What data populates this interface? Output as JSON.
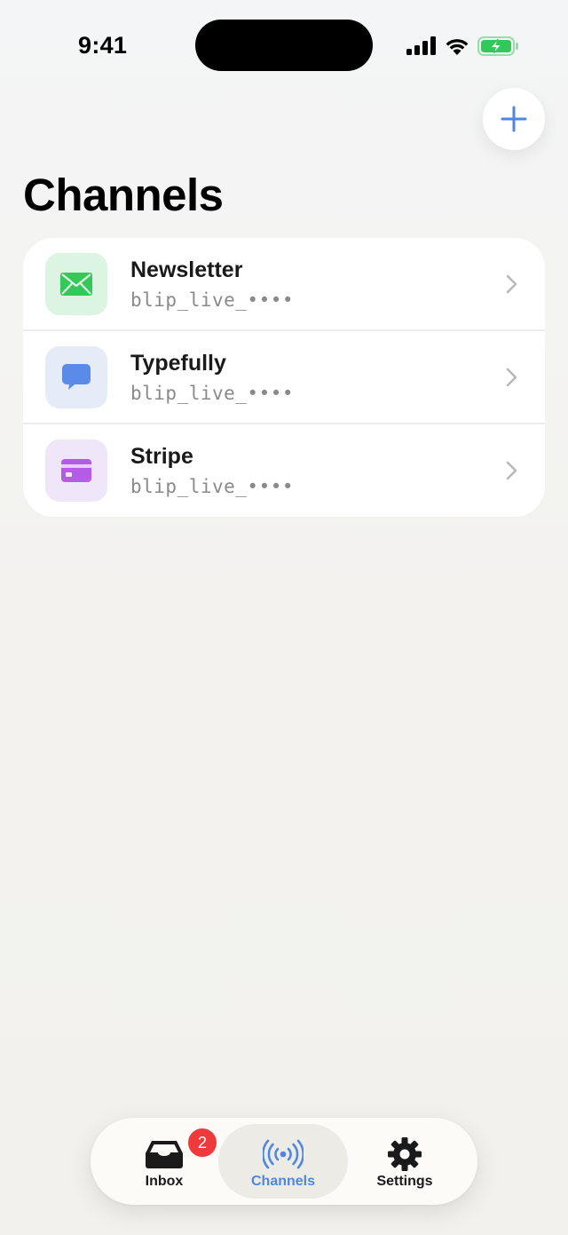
{
  "status_bar": {
    "time": "9:41",
    "icons": [
      "cellular-signal-icon",
      "wifi-icon",
      "battery-charging-icon"
    ],
    "battery_color": "#34c759"
  },
  "header": {
    "add_icon": "plus-icon",
    "title": "Channels"
  },
  "channels": [
    {
      "name": "Newsletter",
      "key": "blip_live_••••",
      "icon": "envelope-icon",
      "icon_color": "#34c759",
      "icon_bg": "#dcf4e2"
    },
    {
      "name": "Typefully",
      "key": "blip_live_••••",
      "icon": "chat-bubble-icon",
      "icon_color": "#5b8be8",
      "icon_bg": "#e6ebf8"
    },
    {
      "name": "Stripe",
      "key": "blip_live_••••",
      "icon": "credit-card-icon",
      "icon_color": "#b45ce6",
      "icon_bg": "#efe6fa"
    }
  ],
  "tab_bar": {
    "tabs": [
      {
        "label": "Inbox",
        "icon": "inbox-tray-icon",
        "badge": "2",
        "active": false
      },
      {
        "label": "Channels",
        "icon": "broadcast-icon",
        "active": true
      },
      {
        "label": "Settings",
        "icon": "gear-icon",
        "active": false
      }
    ],
    "accent_color": "#4f86e0",
    "badge_color": "#ee3a3a"
  }
}
